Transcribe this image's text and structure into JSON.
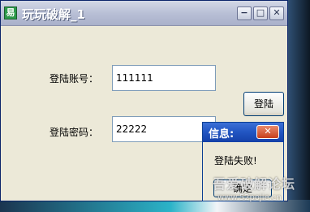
{
  "main_window": {
    "title": "玩玩破解_1",
    "app_icon": "易",
    "controls": {
      "minimize": "−",
      "maximize": "□",
      "close": "✕"
    }
  },
  "form": {
    "account_label": "登陆账号：",
    "account_value": "111111",
    "password_label": "登陆密码：",
    "password_value": "22222",
    "login_button": "登陆"
  },
  "message_box": {
    "title": "信息:",
    "close_glyph": "✕",
    "message": "登陆失败!",
    "ok_button": "确定"
  },
  "watermark": {
    "text": "吾爱破解论坛",
    "url": "www.52pojie.cn"
  },
  "colors": {
    "window_bg": "#ece9d8",
    "msg_titlebar": "#2357c4",
    "close_red": "#c9401b"
  }
}
